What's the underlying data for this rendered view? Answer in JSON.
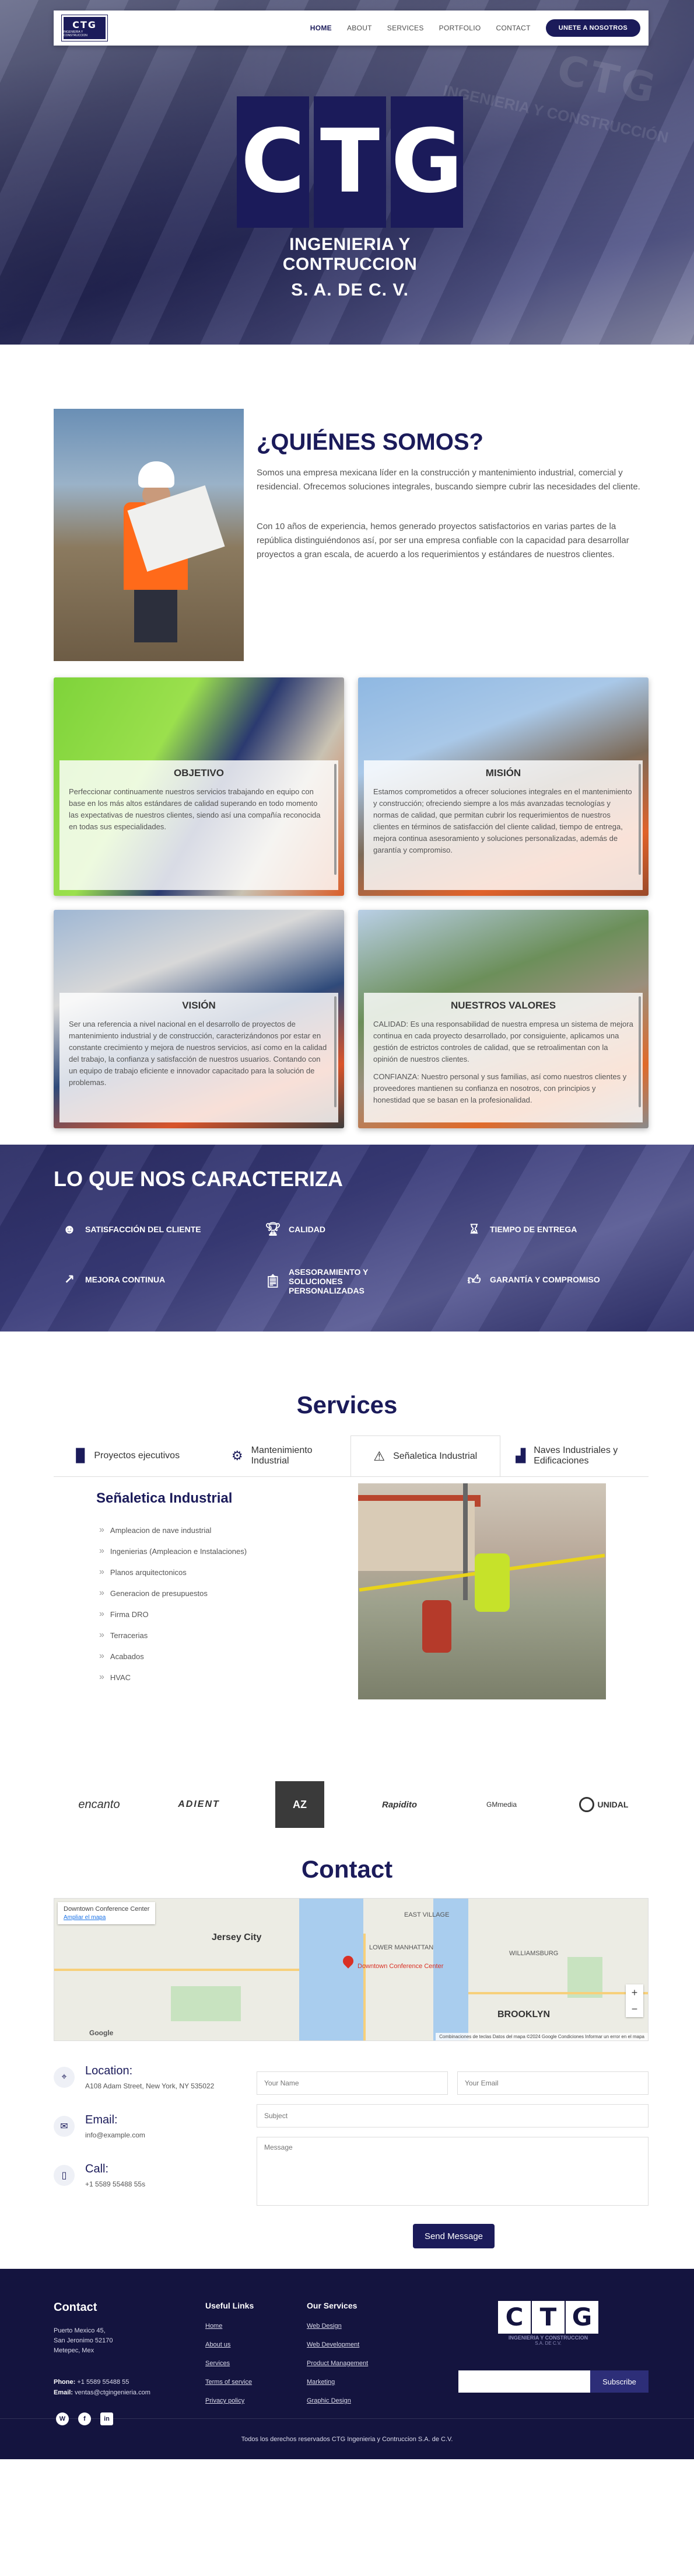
{
  "nav": {
    "logo_text": "CTG",
    "logo_sub": "INGENIERIA Y CONSTRUCCION",
    "items": [
      "HOME",
      "ABOUT",
      "SERVICES",
      "PORTFOLIO",
      "CONTACT"
    ],
    "cta": "UNETE A NOSOTROS"
  },
  "hero": {
    "letters": [
      "C",
      "T",
      "G"
    ],
    "tagline1": "INGENIERIA Y CONTRUCCION",
    "tagline2": "S. A. DE C. V.",
    "flag_text": "CTG",
    "flag_sub": "INGENIERIA Y CONSTRUCCIÓN"
  },
  "about": {
    "title": "¿QUIÉNES SOMOS?",
    "p1": "Somos una empresa mexicana líder en la construcción y mantenimiento industrial, comercial y residencial. Ofrecemos soluciones integrales, buscando siempre cubrir las necesidades del cliente.",
    "p2": "Con 10 años de experiencia, hemos generado proyectos satisfactorios en varias partes de la república distinguiéndonos así, por ser una empresa confiable con la capacidad para desarrollar proyectos a gran escala, de acuerdo a los requerimientos y estándares de nuestros clientes."
  },
  "cards": [
    {
      "title": "OBJETIVO",
      "text": "Perfeccionar continuamente nuestros servicios trabajando en equipo con base en los más altos estándares de calidad superando en todo momento las expectativas de nuestros clientes, siendo así una compañía reconocida en todas sus especialidades."
    },
    {
      "title": "MISIÓN",
      "text": "Estamos comprometidos a ofrecer soluciones integrales en el mantenimiento y construcción; ofreciendo siempre a los más avanzadas tecnologías y normas de calidad, que permitan cubrir los requerimientos de nuestros clientes en términos de satisfacción del cliente calidad, tiempo de entrega, mejora continua asesoramiento y soluciones personalizadas, además de garantía y compromiso."
    },
    {
      "title": "VISIÓN",
      "text": "Ser una referencia a nivel nacional en el desarrollo de proyectos de mantenimiento industrial y de construcción, caracterizándonos por estar en constante crecimiento y mejora de nuestros servicios, así como en la calidad del trabajo, la confianza y satisfacción de nuestros usuarios. Contando con un equipo de trabajo eficiente e innovador capacitado para la solución de problemas."
    },
    {
      "title": "NUESTROS VALORES",
      "text1": "CALIDAD: Es una responsabilidad de nuestra empresa un sistema de mejora continua en cada proyecto desarrollado, por consiguiente, aplicamos una gestión de estrictos controles de calidad, que se retroalimentan con la opinión de nuestros clientes.",
      "text2": "CONFIANZA: Nuestro personal y sus familias, así como nuestros clientes y proveedores mantienen su confianza en nosotros, con principios y honestidad que se basan en la profesionalidad."
    }
  ],
  "carac": {
    "title": "LO QUE NOS CARACTERIZA",
    "items": [
      {
        "label": "SATISFACCIÓN DEL CLIENTE",
        "icon": "smile-icon"
      },
      {
        "label": "CALIDAD",
        "icon": "trophy-icon"
      },
      {
        "label": "TIEMPO DE ENTREGA",
        "icon": "hourglass-icon"
      },
      {
        "label": "MEJORA CONTINUA",
        "icon": "chart-up-icon"
      },
      {
        "label": "ASESORAMIENTO Y SOLUCIONES PERSONALIZADAS",
        "icon": "clipboard-icon"
      },
      {
        "label": "GARANTÍA Y COMPROMISO",
        "icon": "thumbs-up-icon"
      }
    ]
  },
  "services": {
    "title": "Services",
    "tabs": [
      {
        "label": "Proyectos ejecutivos",
        "icon": "file-icon"
      },
      {
        "label": "Mantenimiento Industrial",
        "icon": "gear-icon"
      },
      {
        "label": "Señaletica Industrial",
        "icon": "warning-icon"
      },
      {
        "label": "Naves Industriales y Edificaciones",
        "icon": "building-chart-icon"
      }
    ],
    "active_title": "Señaletica Industrial",
    "list": [
      "Ampleacion de nave industrial",
      "Ingenierias (Ampleacion e Instalaciones)",
      "Planos arquitectonicos",
      "Generacion de presupuestos",
      "Firma DRO",
      "Terracerias",
      "Acabados",
      "HVAC"
    ]
  },
  "clients": [
    "encanto",
    "ADIENT",
    "AZ",
    "Rapidito",
    "GMmedia",
    "UNIDAL"
  ],
  "contact": {
    "title": "Contact",
    "map": {
      "place": "Downtown Conference Center",
      "link": "Ampliar el mapa",
      "labels": [
        "Jersey City",
        "EAST VILLAGE",
        "LOWER MANHATTAN",
        "WILLIAMSBURG",
        "BROOKLYN",
        "Downtown Conference Center"
      ],
      "attribution": "Combinaciones de teclas   Datos del mapa ©2024 Google   Condiciones   Informar un error en el mapa",
      "google": "Google"
    },
    "location_label": "Location:",
    "location_value": "A108 Adam Street, New York, NY 535022",
    "email_label": "Email:",
    "email_value": "info@example.com",
    "call_label": "Call:",
    "call_value": "+1 5589 55488 55s",
    "form": {
      "name_ph": "Your Name",
      "email_ph": "Your Email",
      "subject_ph": "Subject",
      "message_ph": "Message",
      "send": "Send Message"
    }
  },
  "footer": {
    "contact_title": "Contact",
    "address1": "Puerto Mexico 45,",
    "address2": "San Jeronimo 52170",
    "address3": "Metepec, Mex",
    "phone_label": "Phone:",
    "phone_value": "+1 5589 55488 55",
    "email_label": "Email:",
    "email_value": "ventas@ctgingenieria.com",
    "useful_title": "Useful Links",
    "useful": [
      "Home",
      "About us",
      "Services",
      "Terms of service",
      "Privacy policy"
    ],
    "services_title": "Our Services",
    "services": [
      "Web Design",
      "Web Development",
      "Product Management",
      "Marketing",
      "Graphic Design"
    ],
    "logo_letters": [
      "C",
      "T",
      "G"
    ],
    "logo_sub": "INGENIERIA Y CONSTRUCCION",
    "logo_sub2": "S.A. DE C.V.",
    "subscribe": "Subscribe",
    "copyright": "Todos los derechos reservados CTG Ingenieria y Contruccion S.A. de C.V."
  }
}
